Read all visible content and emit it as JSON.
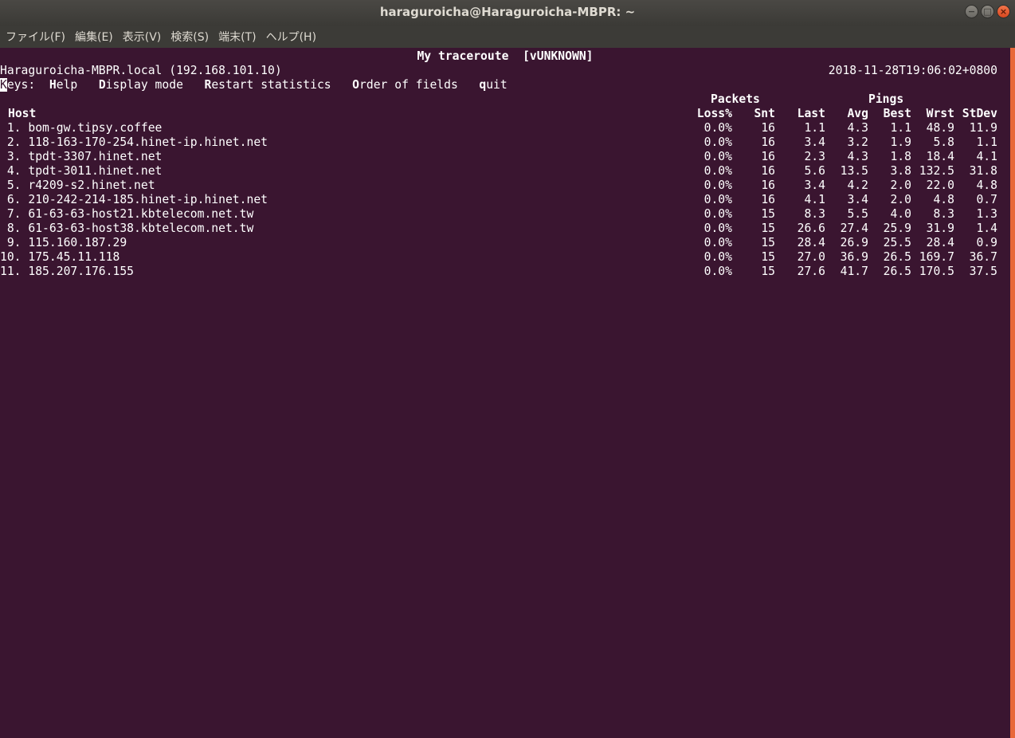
{
  "window": {
    "title": "haraguroicha@Haraguroicha-MBPR: ~",
    "buttons": {
      "minimize": "−",
      "maximize": "□",
      "close": "×"
    }
  },
  "menubar": [
    "ファイル(F)",
    "編集(E)",
    "表示(V)",
    "検索(S)",
    "端末(T)",
    "ヘルプ(H)"
  ],
  "terminal": {
    "title": "My traceroute  [vUNKNOWN]",
    "host_info": "Haraguroicha-MBPR.local (192.168.101.10)",
    "timestamp": "2018-11-28T19:06:02+0800",
    "keys_label": "eys:",
    "keys_cursor_char": "K",
    "keys": [
      {
        "key": "H",
        "rest": "elp"
      },
      {
        "key": "D",
        "rest": "isplay mode"
      },
      {
        "key": "R",
        "rest": "estart statistics"
      },
      {
        "key": "O",
        "rest": "rder of fields"
      },
      {
        "key": "q",
        "rest": "uit"
      }
    ],
    "group_headers": {
      "packets": "Packets",
      "pings": "Pings"
    },
    "columns": [
      "Host",
      "Loss%",
      "Snt",
      "Last",
      "Avg",
      "Best",
      "Wrst",
      "StDev"
    ],
    "rows": [
      {
        "num": " 1.",
        "host": "bom-gw.tipsy.coffee",
        "loss": "0.0%",
        "snt": "16",
        "last": "1.1",
        "avg": "4.3",
        "best": "1.1",
        "wrst": "48.9",
        "stdev": "11.9"
      },
      {
        "num": " 2.",
        "host": "118-163-170-254.hinet-ip.hinet.net",
        "loss": "0.0%",
        "snt": "16",
        "last": "3.4",
        "avg": "3.2",
        "best": "1.9",
        "wrst": "5.8",
        "stdev": "1.1"
      },
      {
        "num": " 3.",
        "host": "tpdt-3307.hinet.net",
        "loss": "0.0%",
        "snt": "16",
        "last": "2.3",
        "avg": "4.3",
        "best": "1.8",
        "wrst": "18.4",
        "stdev": "4.1"
      },
      {
        "num": " 4.",
        "host": "tpdt-3011.hinet.net",
        "loss": "0.0%",
        "snt": "16",
        "last": "5.6",
        "avg": "13.5",
        "best": "3.8",
        "wrst": "132.5",
        "stdev": "31.8"
      },
      {
        "num": " 5.",
        "host": "r4209-s2.hinet.net",
        "loss": "0.0%",
        "snt": "16",
        "last": "3.4",
        "avg": "4.2",
        "best": "2.0",
        "wrst": "22.0",
        "stdev": "4.8"
      },
      {
        "num": " 6.",
        "host": "210-242-214-185.hinet-ip.hinet.net",
        "loss": "0.0%",
        "snt": "16",
        "last": "4.1",
        "avg": "3.4",
        "best": "2.0",
        "wrst": "4.8",
        "stdev": "0.7"
      },
      {
        "num": " 7.",
        "host": "61-63-63-host21.kbtelecom.net.tw",
        "loss": "0.0%",
        "snt": "15",
        "last": "8.3",
        "avg": "5.5",
        "best": "4.0",
        "wrst": "8.3",
        "stdev": "1.3"
      },
      {
        "num": " 8.",
        "host": "61-63-63-host38.kbtelecom.net.tw",
        "loss": "0.0%",
        "snt": "15",
        "last": "26.6",
        "avg": "27.4",
        "best": "25.9",
        "wrst": "31.9",
        "stdev": "1.4"
      },
      {
        "num": " 9.",
        "host": "115.160.187.29",
        "loss": "0.0%",
        "snt": "15",
        "last": "28.4",
        "avg": "26.9",
        "best": "25.5",
        "wrst": "28.4",
        "stdev": "0.9"
      },
      {
        "num": "10.",
        "host": "175.45.11.118",
        "loss": "0.0%",
        "snt": "15",
        "last": "27.0",
        "avg": "36.9",
        "best": "26.5",
        "wrst": "169.7",
        "stdev": "36.7"
      },
      {
        "num": "11.",
        "host": "185.207.176.155",
        "loss": "0.0%",
        "snt": "15",
        "last": "27.6",
        "avg": "41.7",
        "best": "26.5",
        "wrst": "170.5",
        "stdev": "37.5"
      }
    ]
  },
  "colors": {
    "terminal_bg": "#3a1530",
    "titlebar_bg": "#3c3b37",
    "close_button": "#e8683a"
  }
}
